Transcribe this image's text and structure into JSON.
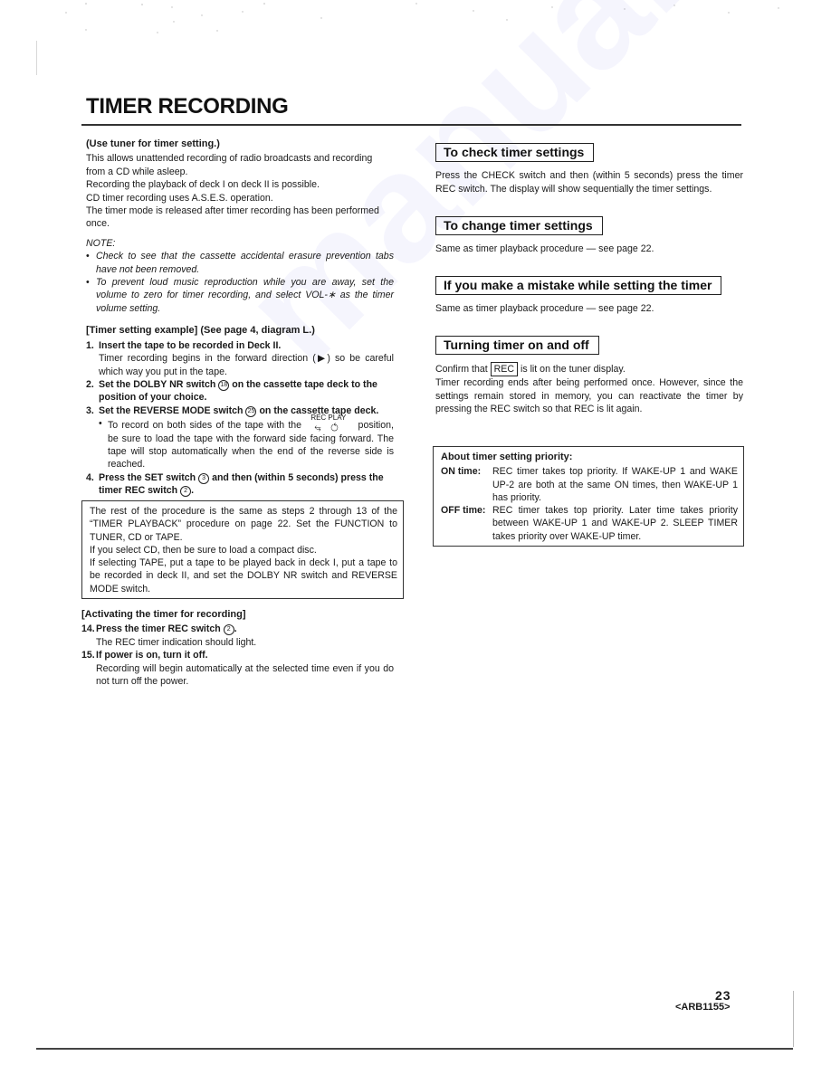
{
  "page": {
    "title": "TIMER RECORDING",
    "page_number": "23",
    "document_code": "<ARB1155>",
    "watermark": "manualslib.com"
  },
  "left": {
    "intro": {
      "heading": "(Use tuner for timer setting.)",
      "lines": [
        "This allows unattended recording of radio broadcasts and recording from a CD while asleep.",
        "Recording the playback of deck I on deck II is possible.",
        "CD timer recording uses A.S.E.S. operation.",
        "The timer mode is released after timer recording has been performed once."
      ]
    },
    "note": {
      "label": "NOTE:",
      "items": [
        "Check to see that the cassette accidental erasure prevention tabs have not been removed.",
        "To prevent loud music reproduction while you are away, set the volume to zero for timer recording, and select VOL-∗ as the timer volume setting."
      ]
    },
    "example": {
      "heading": "[Timer setting example] (See page 4, diagram L.)",
      "steps": [
        {
          "num": "1.",
          "head": "Insert the tape to be recorded in Deck II.",
          "body": "Timer recording begins in the forward direction (▶) so be careful which way you put in the tape."
        },
        {
          "num": "2.",
          "head_before": "Set the DOLBY NR switch",
          "ref": "18",
          "head_after": "on the cassette tape deck to the position of your choice."
        },
        {
          "num": "3.",
          "head_before": "Set the REVERSE MODE switch",
          "ref": "25",
          "head_after": "on the cassette tape deck.",
          "bullet_before": "To record on both sides of the tape with the",
          "symbol_label": "REC PLAY",
          "symbol_glyph": "⥃ ⥀",
          "bullet_after": "position, be sure to load the tape with the forward side facing forward. The tape will stop automatically when the end of the reverse side is reached."
        },
        {
          "num": "4.",
          "head_a": "Press the SET switch",
          "ref_a": "3",
          "head_b": "and then (within 5 seconds) press the timer REC switch",
          "ref_b": "2"
        }
      ]
    },
    "rest_box": [
      "The rest of the procedure is the same as steps 2 through 13 of the “TIMER PLAYBACK” procedure on page 22. Set the FUNCTION to TUNER, CD or TAPE.",
      "If you select CD, then be sure to load a compact disc.",
      "If selecting TAPE, put a tape to be played back in deck I, put a tape to be recorded in deck II, and set the DOLBY NR switch and REVERSE MODE switch."
    ],
    "activating": {
      "heading": "[Activating the timer for recording]",
      "steps": [
        {
          "num": "14.",
          "head": "Press the timer REC switch",
          "ref": "2",
          "body": "The REC timer indication should light."
        },
        {
          "num": "15.",
          "head": "If power is on, turn it off.",
          "body": "Recording will begin automatically at the selected time even if you do not turn off the power."
        }
      ]
    }
  },
  "right": {
    "check": {
      "heading": "To check timer settings",
      "body": "Press the CHECK switch and then (within 5 seconds) press the timer REC switch. The display will show sequentially the timer settings."
    },
    "change": {
      "heading": "To change timer settings",
      "body": "Same as timer playback procedure — see page 22."
    },
    "mistake": {
      "heading": "If you make a mistake while setting the timer",
      "body": "Same as timer playback procedure — see page 22."
    },
    "onoff": {
      "heading": "Turning timer on and off",
      "confirm_before": "Confirm that",
      "rec_indicator": "REC",
      "confirm_after": "is lit on the tuner display.",
      "body": "Timer recording ends after being performed once. However, since the settings remain stored in memory, you can reactivate the timer by pressing the REC switch so that REC is lit again."
    },
    "priority": {
      "heading": "About timer setting priority:",
      "rows": [
        {
          "term": "ON time:",
          "def": "REC timer takes top priority. If WAKE-UP 1 and WAKE UP-2 are both at the same ON times, then WAKE-UP 1 has priority."
        },
        {
          "term": "OFF time:",
          "def": "REC timer takes top priority. Later time takes priority between WAKE-UP 1 and WAKE-UP 2. SLEEP TIMER takes priority over WAKE-UP timer."
        }
      ]
    }
  }
}
